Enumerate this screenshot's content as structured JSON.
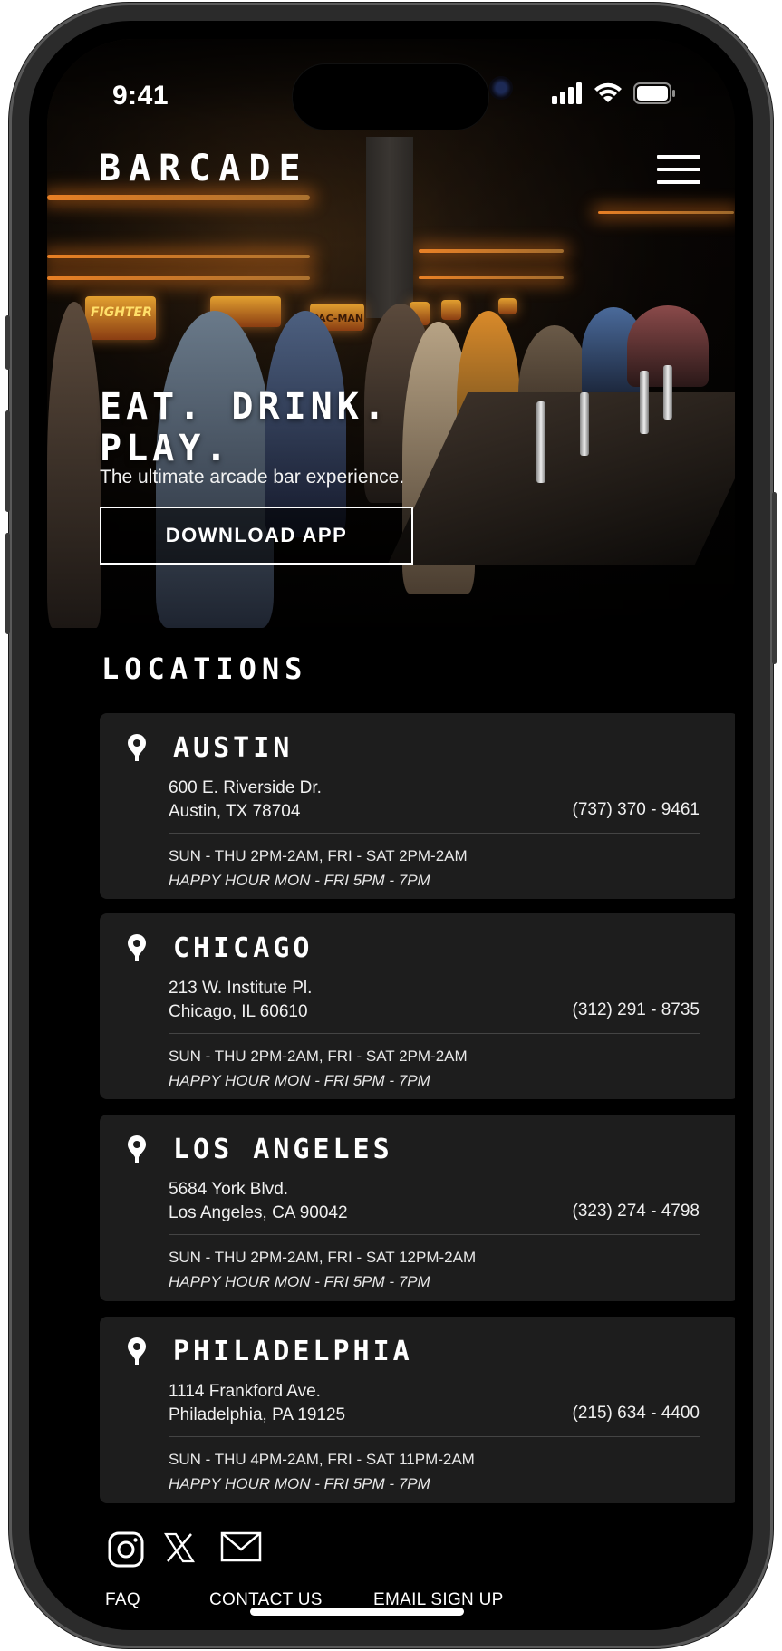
{
  "status_bar": {
    "time": "9:41"
  },
  "header": {
    "logo": "BARCADE",
    "menu_icon": "hamburger-menu-icon"
  },
  "hero": {
    "headline_line1": "EAT. DRINK.",
    "headline_line2": "PLAY.",
    "tagline": "The ultimate arcade bar experience.",
    "cta_label": "DOWNLOAD APP",
    "marquees": [
      "FIGHTER II",
      "PAC-MAN"
    ]
  },
  "locations": {
    "title": "LOCATIONS",
    "items": [
      {
        "city": "AUSTIN",
        "address_line1": "600 E. Riverside Dr.",
        "address_line2": "Austin, TX 78704",
        "phone": "(737) 370 - 9461",
        "hours": "SUN - THU 2PM-2AM, FRI - SAT 2PM-2AM",
        "happy_hour": "HAPPY HOUR MON - FRI 5PM - 7PM"
      },
      {
        "city": "CHICAGO",
        "address_line1": "213 W. Institute Pl.",
        "address_line2": "Chicago, IL 60610",
        "phone": "(312) 291 - 8735",
        "hours": "SUN - THU 2PM-2AM, FRI - SAT 2PM-2AM",
        "happy_hour": "HAPPY HOUR MON - FRI 5PM - 7PM"
      },
      {
        "city": "LOS ANGELES",
        "address_line1": "5684 York Blvd.",
        "address_line2": "Los Angeles, CA 90042",
        "phone": "(323) 274 - 4798",
        "hours": "SUN - THU 2PM-2AM, FRI - SAT 12PM-2AM",
        "happy_hour": "HAPPY HOUR MON - FRI 5PM - 7PM"
      },
      {
        "city": "PHILADELPHIA",
        "address_line1": "1114 Frankford Ave.",
        "address_line2": "Philadelphia, PA 19125",
        "phone": "(215) 634 - 4400",
        "hours": "SUN - THU 4PM-2AM, FRI - SAT 11PM-2AM",
        "happy_hour": "HAPPY HOUR MON - FRI 5PM - 7PM"
      }
    ]
  },
  "footer": {
    "social_icons": [
      "instagram-icon",
      "x-icon",
      "mail-icon"
    ],
    "links": [
      "FAQ",
      "CONTACT US",
      "EMAIL SIGN UP"
    ]
  },
  "colors": {
    "background": "#000000",
    "card": "#1d1d1d",
    "text": "#ffffff",
    "accent_glow": "#ff8c28"
  }
}
